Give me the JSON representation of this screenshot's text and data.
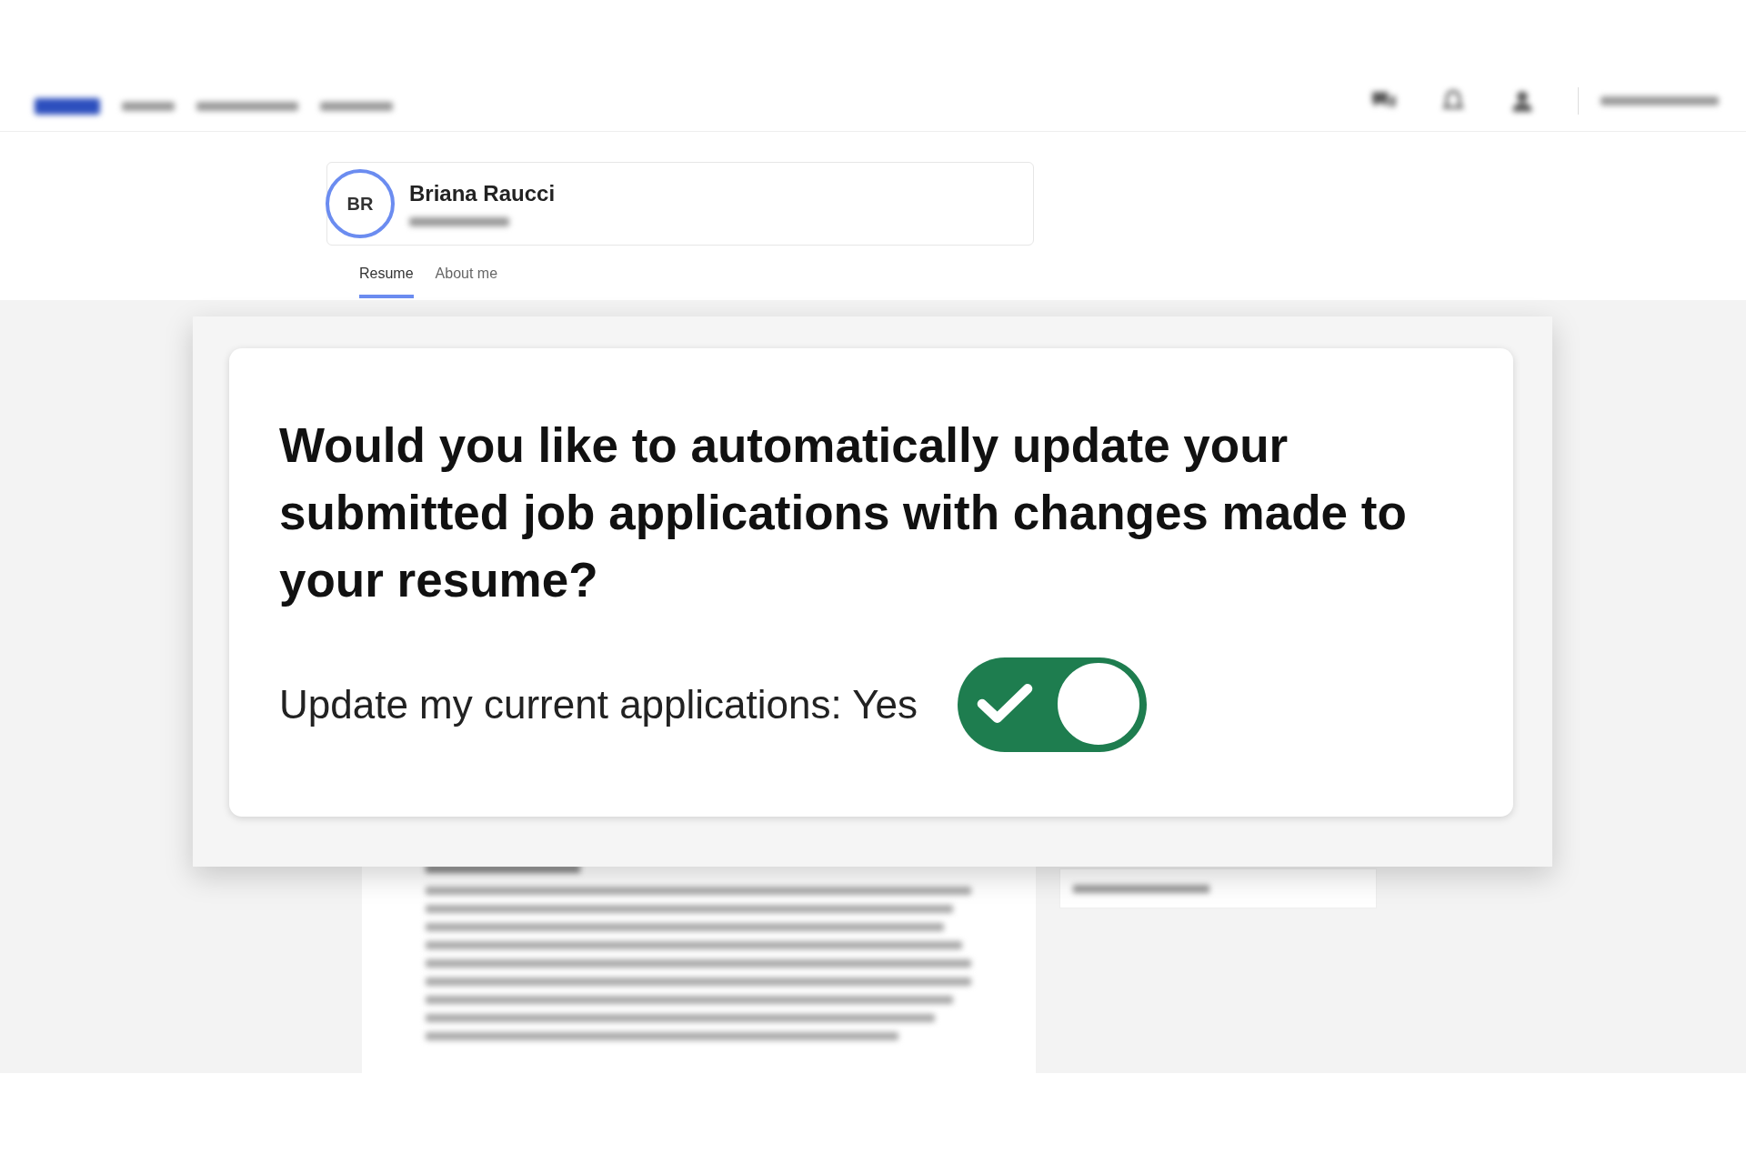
{
  "profile": {
    "initials": "BR",
    "name": "Briana Raucci"
  },
  "profile_tabs": [
    {
      "label": "Resume",
      "selected": true
    },
    {
      "label": "About me",
      "selected": false
    }
  ],
  "dialog": {
    "question": "Would you like to automatically update your submitted job applications with changes made to your resume?",
    "toggle_label": "Update my current applications: Yes",
    "toggle": {
      "on": true
    }
  }
}
